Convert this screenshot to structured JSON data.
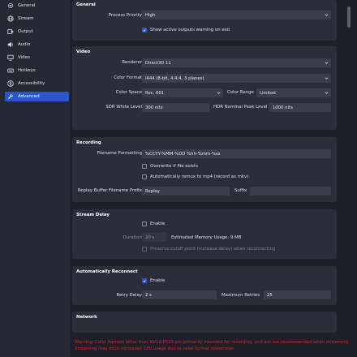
{
  "sidebar": {
    "items": [
      {
        "label": "General",
        "icon": "gear-icon"
      },
      {
        "label": "Stream",
        "icon": "globe-icon"
      },
      {
        "label": "Output",
        "icon": "output-icon"
      },
      {
        "label": "Audio",
        "icon": "speaker-icon"
      },
      {
        "label": "Video",
        "icon": "monitor-icon"
      },
      {
        "label": "Hotkeys",
        "icon": "keyboard-icon"
      },
      {
        "label": "Accessibility",
        "icon": "accessibility-icon"
      },
      {
        "label": "Advanced",
        "icon": "wrench-icon",
        "active": true
      }
    ]
  },
  "general": {
    "title": "General",
    "process_priority_label": "Process Priority",
    "process_priority_value": "High",
    "show_active_outputs_label": "Show active outputs warning on exit",
    "show_active_outputs_checked": true
  },
  "video": {
    "title": "Video",
    "renderer_label": "Renderer",
    "renderer_value": "Direct3D 11",
    "color_format_label": "Color Format",
    "color_format_value": "I444 (8-bit, 4:4:4, 3 planes)",
    "color_space_label": "Color Space",
    "color_space_value": "Rec. 601",
    "color_range_label": "Color Range",
    "color_range_value": "Limited",
    "sdr_white_label": "SDR White Level",
    "sdr_white_value": "300 nits",
    "hdr_peak_label": "HDR Nominal Peak Level",
    "hdr_peak_value": "1000 nits"
  },
  "recording": {
    "title": "Recording",
    "filename_label": "Filename Formatting",
    "filename_value": "%CCYY-%MM-%DD %hh-%mm-%ss",
    "overwrite_label": "Overwrite if file exists",
    "overwrite_checked": false,
    "remux_label": "Automatically remux to mp4 (record as mkv)",
    "remux_checked": false,
    "replay_prefix_label": "Replay Buffer Filename Prefix",
    "replay_prefix_value": "Replay",
    "suffix_label": "Suffix",
    "suffix_value": ""
  },
  "stream_delay": {
    "title": "Stream Delay",
    "enable_label": "Enable",
    "enable_checked": false,
    "duration_label": "Duration",
    "duration_value": "20 s",
    "memory_usage": "Estimated Memory Usage: 9 MB",
    "preserve_label": "Preserve cutoff point (increase delay) when reconnecting",
    "preserve_checked": false
  },
  "reconnect": {
    "title": "Automatically Reconnect",
    "enable_label": "Enable",
    "enable_checked": true,
    "retry_delay_label": "Retry Delay",
    "retry_delay_value": "2 s",
    "max_retries_label": "Maximum Retries",
    "max_retries_value": "25"
  },
  "network": {
    "title": "Network"
  },
  "warning": {
    "text": "Warning: Color formats other than NV12/P010 are primarily intended for recording, and are not recommended when streaming. Streaming may incur increased CPU usage due to color format conversion."
  },
  "colors": {
    "accent": "#2a56c6",
    "warning": "#d22a2a",
    "panel": "#2b2d3a",
    "background": "#1e1f29"
  }
}
